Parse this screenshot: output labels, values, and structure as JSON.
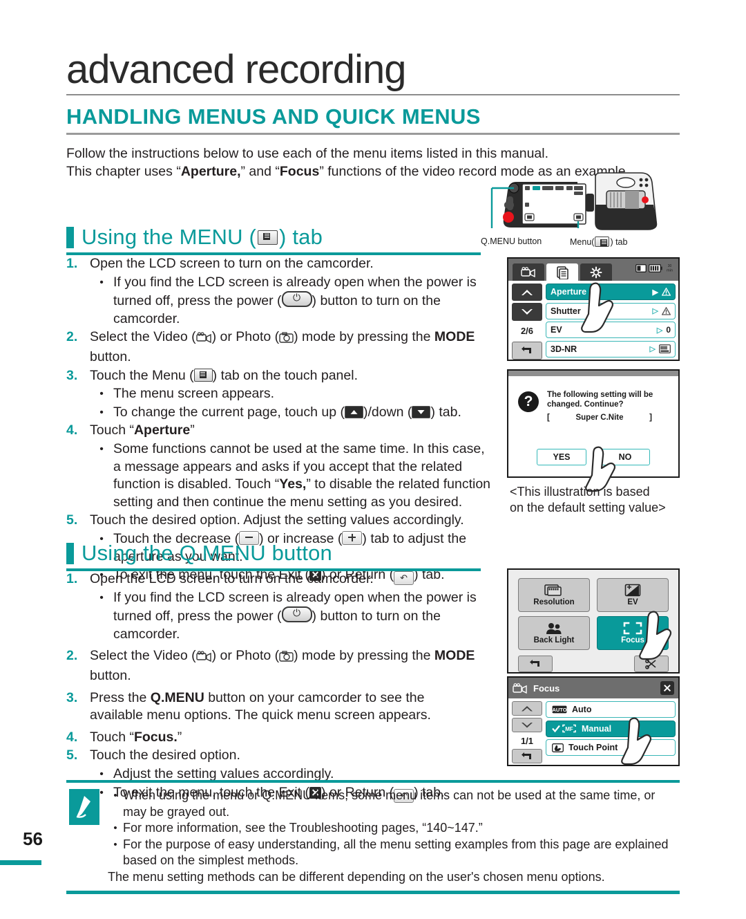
{
  "page": {
    "chapter_title": "advanced recording",
    "section_title": "HANDLING MENUS AND QUICK MENUS",
    "intro_line1": "Follow the instructions below to use each of the menu items listed in this manual.",
    "intro_line2_a": "This chapter uses “",
    "intro_line2_b": "Aperture,",
    "intro_line2_c": "” and “",
    "intro_line2_d": "Focus",
    "intro_line2_e": "” functions of the video record mode as an example.",
    "page_number": "56"
  },
  "menu_section": {
    "heading_pre": "Using the MENU (",
    "heading_post": ") tab",
    "steps": [
      {
        "num": "1.",
        "text": "Open the LCD screen to turn on the camcorder.",
        "bullets": [
          {
            "pre": "If you find the LCD screen is already open when the power is turned off, press the power (",
            "post": ") button to turn on the camcorder.",
            "icon": "power-icon"
          }
        ]
      },
      {
        "num": "2.",
        "pre": "Select the Video (",
        "mid": ") or Photo (",
        "post": ") mode by pressing the ",
        "bold": "MODE",
        "tail": " button."
      },
      {
        "num": "3.",
        "pre": "Touch the Menu (",
        "post": ") tab on the touch panel.",
        "bullets": [
          {
            "text": "The menu screen appears."
          },
          {
            "pre": "To change the current page, touch up (",
            "mid": ")/down (",
            "post": ") tab."
          }
        ]
      },
      {
        "num": "4.",
        "pre": "Touch “",
        "bold": "Aperture",
        "post": "”",
        "bullets": [
          {
            "pre": "Some functions cannot be used at the same time. In this case, a message appears and asks if you accept that the related function is disabled. Touch “",
            "bold": "Yes,",
            "post": "” to disable the related function setting and then continue the menu setting as you desired."
          }
        ]
      },
      {
        "num": "5.",
        "text": "Touch the desired option. Adjust the setting values accordingly.",
        "bullets": [
          {
            "pre": "Touch the decrease (",
            "mid": ") or increase (",
            "post": ") tab to adjust the aperture as you want."
          },
          {
            "pre": "To exit the menu, touch the Exit (",
            "mid": ") or Return (",
            "post": ") tab."
          }
        ]
      }
    ]
  },
  "qmenu_section": {
    "heading": "Using the Q.MENU button",
    "steps": [
      {
        "num": "1.",
        "text": "Open the LCD screen to turn on the camcorder.",
        "bullets": [
          {
            "pre": "If you find the LCD screen is already open when the power is turned off, press the power (",
            "post": ") button to turn on the camcorder."
          }
        ]
      },
      {
        "num": "2.",
        "pre": "Select the Video (",
        "mid": ") or Photo (",
        "post": ") mode by pressing the ",
        "bold": "MODE",
        "tail": " button."
      },
      {
        "num": "3.",
        "pre": "Press the ",
        "bold": "Q.MENU",
        "post": " button on your camcorder to see the available menu options. The quick menu screen appears."
      },
      {
        "num": "4.",
        "pre": "Touch “",
        "bold": "Focus.",
        "post": "”"
      },
      {
        "num": "5.",
        "text": "Touch the desired option.",
        "bullets": [
          {
            "text": "Adjust the setting values accordingly."
          },
          {
            "pre": "To exit the menu, touch the Exit (",
            "mid": ") or Return (",
            "post": ") tab."
          }
        ]
      }
    ]
  },
  "camcorder_figure": {
    "label_qmenu": "Q.MENU button",
    "label_menu_pre": "Menu(",
    "label_menu_post": ") tab"
  },
  "lcd_menu_screen": {
    "tabs": [
      "video-tab-icon",
      "menu-tab-icon",
      "settings-tab-icon"
    ],
    "status_icons": [
      "card-icon",
      "battery-icon",
      "record-time-icon"
    ],
    "page_indicator": "2/6",
    "rows": [
      {
        "label": "Aperture",
        "value": "warning-icon",
        "selected": true
      },
      {
        "label": "Shutter",
        "value": "warning-icon",
        "selected": false
      },
      {
        "label": "EV",
        "value": "0",
        "selected": false
      },
      {
        "label": "3D-NR",
        "value": "3dnr-icon",
        "selected": false
      }
    ]
  },
  "lcd_dialog_screen": {
    "message_line1": "The following setting will be",
    "message_line2": "changed. Continue?",
    "bracket_open": "[",
    "value": "Super C.Nite",
    "bracket_close": "]",
    "yes_label": "YES",
    "no_label": "NO"
  },
  "caption": {
    "line1": "<This illustration is based",
    "line2": "on the default setting value>"
  },
  "lcd_quickmenu_screen": {
    "cells": [
      {
        "label": "Resolution",
        "icon": "resolution-icon",
        "selected": false
      },
      {
        "label": "EV",
        "icon": "ev-icon",
        "selected": false
      },
      {
        "label": "Back Light",
        "icon": "backlight-icon",
        "selected": false
      },
      {
        "label": "Focus",
        "icon": "focus-icon",
        "selected": true
      }
    ],
    "return_icon": "return-icon",
    "cut_icon": "scissors-icon"
  },
  "lcd_focus_screen": {
    "title": "Focus",
    "page_indicator": "1/1",
    "options": [
      {
        "label": "Auto",
        "icon": "auto-icon",
        "selected": false
      },
      {
        "label": "Manual",
        "icon": "mf-icon",
        "selected": true
      },
      {
        "label": "Touch Point",
        "icon": "touchpoint-icon",
        "selected": false
      }
    ]
  },
  "note_box": {
    "icon": "note-pencil-icon",
    "items": [
      {
        "text": "When using the menu or Q.MENU items, some menu items can not be used at the same time, or may be grayed out."
      },
      {
        "text": "For more information, see the Troubleshooting pages, “140~147.”"
      },
      {
        "text": "For the purpose of easy understanding, all the menu setting examples from this page are explained based on the simplest methods.",
        "continuation": "The menu setting methods can be different depending on the user's chosen menu options."
      }
    ]
  },
  "colors": {
    "teal": "#0a9a9a",
    "text": "#231f20",
    "rule_gray": "#8c8c8c"
  }
}
